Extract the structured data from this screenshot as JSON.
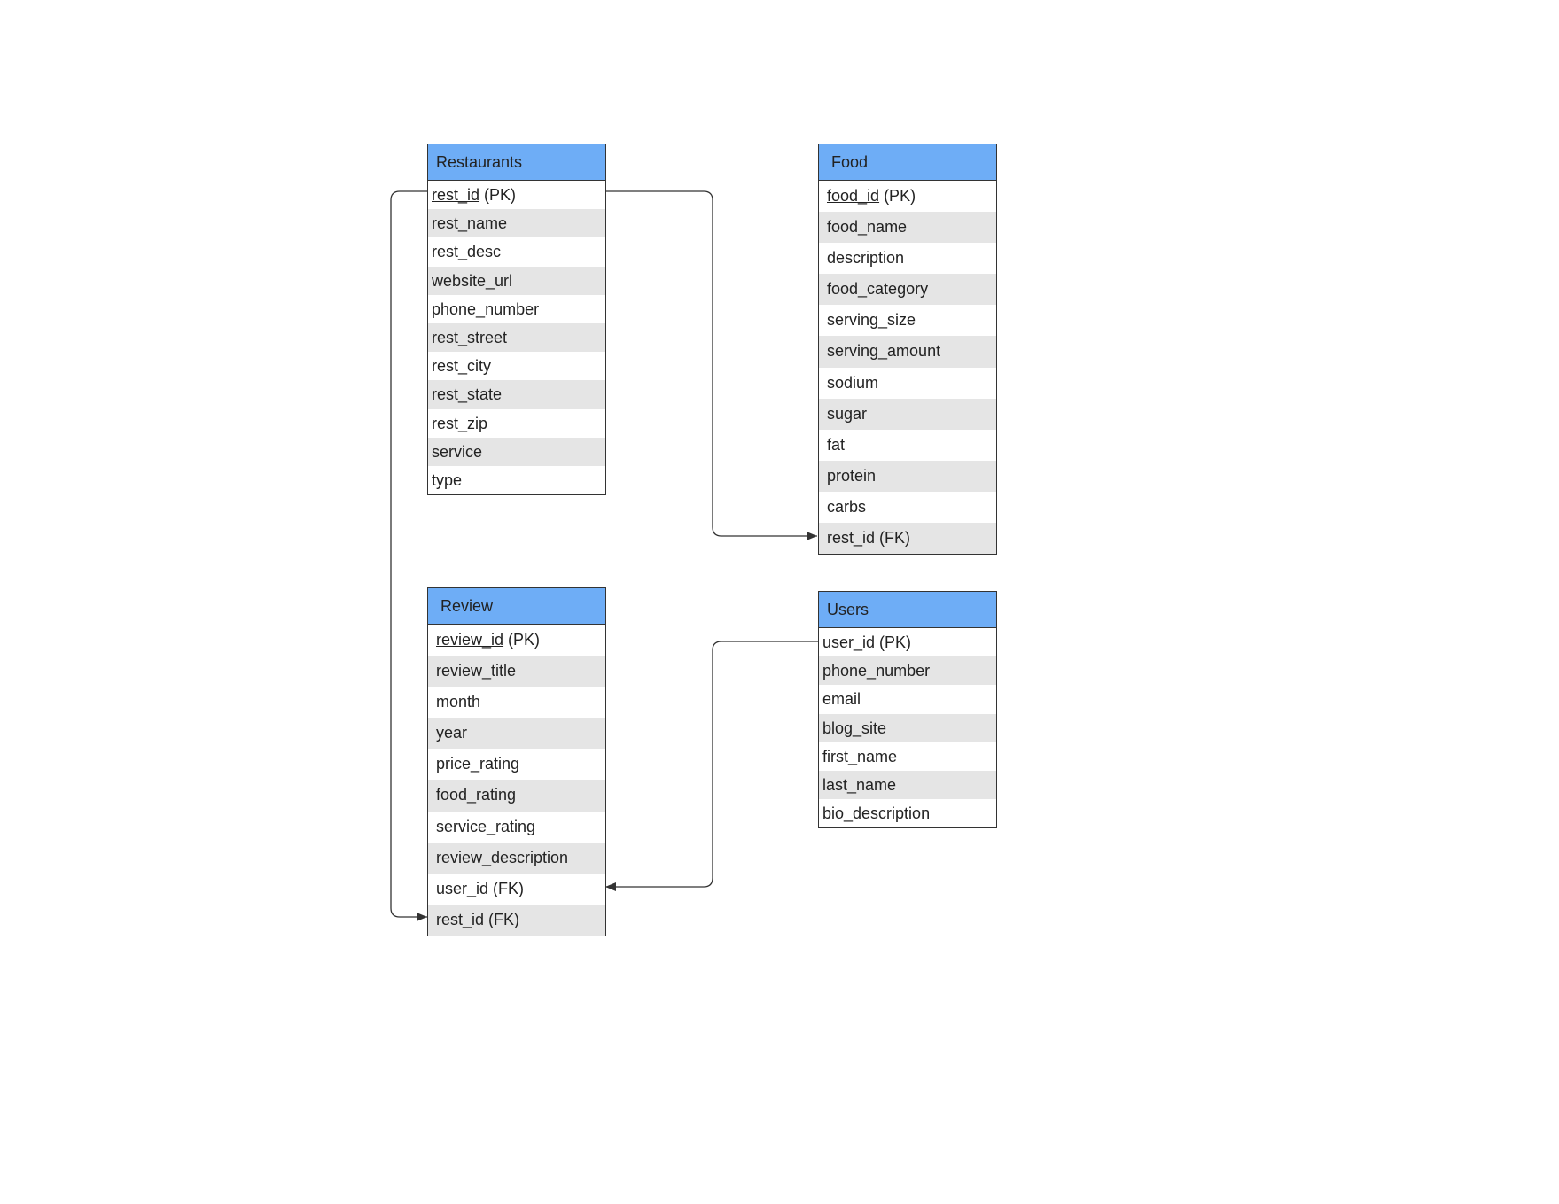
{
  "colors": {
    "header_fill": "#6eadf6",
    "alt_row_fill": "#e5e5e5",
    "border": "#333333",
    "text": "#222222"
  },
  "entities": {
    "restaurants": {
      "title": "Restaurants",
      "pk": {
        "key": "rest_id",
        "suffix": " (PK)"
      },
      "fields": [
        "rest_name",
        "rest_desc",
        "website_url",
        "phone_number",
        "rest_street",
        "rest_city",
        "rest_state",
        "rest_zip",
        "service",
        "type"
      ]
    },
    "food": {
      "title": "Food",
      "pk": {
        "key": "food_id",
        "suffix": " (PK)"
      },
      "fields": [
        "food_name",
        "description",
        "food_category",
        "serving_size",
        "serving_amount",
        "sodium",
        "sugar",
        "fat",
        "protein",
        "carbs",
        "rest_id (FK)"
      ]
    },
    "review": {
      "title": "Review",
      "pk": {
        "key": "review_id",
        "suffix": " (PK)"
      },
      "fields": [
        "review_title",
        "month",
        "year",
        "price_rating",
        "food_rating",
        "service_rating",
        "review_description",
        "user_id (FK)",
        "rest_id (FK)"
      ]
    },
    "users": {
      "title": "Users",
      "pk": {
        "key": "user_id",
        "suffix": " (PK)"
      },
      "fields": [
        "phone_number",
        "email",
        "blog_site",
        "first_name",
        "last_name",
        "bio_description"
      ]
    }
  },
  "relationships": [
    {
      "from": "restaurants.rest_id",
      "to": "food.rest_id (FK)"
    },
    {
      "from": "restaurants.rest_id",
      "to": "review.rest_id (FK)"
    },
    {
      "from": "users.user_id",
      "to": "review.user_id (FK)"
    }
  ]
}
